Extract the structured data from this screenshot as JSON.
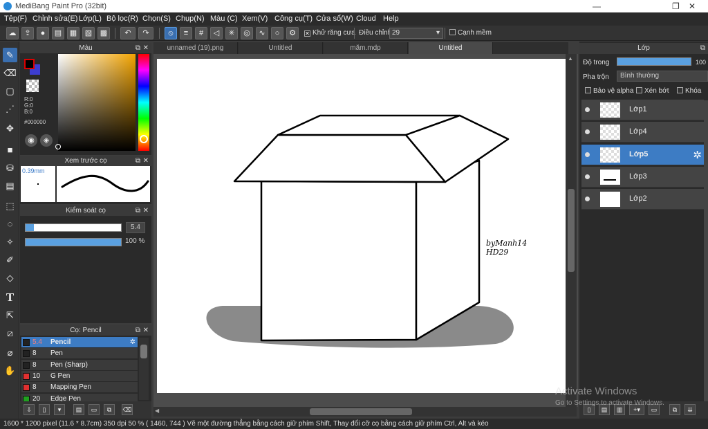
{
  "window": {
    "title": "MediBang Paint Pro (32bit)",
    "minimize": "—",
    "maximize": "❐",
    "close": "✕"
  },
  "menu": [
    "Tệp(F)",
    "Chỉnh sửa(E)",
    "Lớp(L)",
    "Bộ lọc(R)",
    "Chọn(S)",
    "Chụp(N)",
    "Màu (C)",
    "Xem(V)",
    "Công cụ(T)",
    "Cửa sổ(W)",
    "Cloud",
    "Help"
  ],
  "toolbar": {
    "antialias_label": "Khử răng cưa",
    "adjust_label": "Điều chỉnh",
    "adjust_value": "29",
    "edge_label": "Cạnh mềm"
  },
  "color_panel": {
    "title": "Màu",
    "r": "R:0",
    "g": "G:0",
    "b": "B:0",
    "hex": "#000000"
  },
  "brush_preview": {
    "title": "Xem trước cọ",
    "size": "0.39mm"
  },
  "brush_control": {
    "title": "Kiểm soát cọ",
    "size_value": "5.4",
    "opacity_value": "100 %"
  },
  "brush_list": {
    "title": "Cọ: Pencil",
    "items": [
      {
        "size": "5.4",
        "name": "Pencil",
        "color": "#222222"
      },
      {
        "size": "8",
        "name": "Pen",
        "color": "#222222"
      },
      {
        "size": "8",
        "name": "Pen (Sharp)",
        "color": "#222222"
      },
      {
        "size": "10",
        "name": "G Pen",
        "color": "#e03030"
      },
      {
        "size": "8",
        "name": "Mapping Pen",
        "color": "#e03030"
      },
      {
        "size": "20",
        "name": "Edge Pen",
        "color": "#20a020"
      }
    ]
  },
  "tabs": [
    "unnamed (19).png",
    "Untitled",
    "măm.mdp",
    "Untitled"
  ],
  "canvas": {
    "signature_line1": "byManh14",
    "signature_line2": "HD29"
  },
  "layer_panel": {
    "title": "Lớp",
    "opacity_label": "Độ trong",
    "opacity_value": "100",
    "blend_label": "Pha trộn",
    "blend_value": "Bình thường",
    "protect_alpha": "Bảo vệ alpha",
    "clipping": "Xén bớt",
    "lock": "Khóa",
    "layers": [
      {
        "name": "Lớp1"
      },
      {
        "name": "Lớp4"
      },
      {
        "name": "Lớp5"
      },
      {
        "name": "Lớp3"
      },
      {
        "name": "Lớp2"
      }
    ]
  },
  "watermark": {
    "line1": "Activate Windows",
    "line2": "Go to Settings to activate Windows."
  },
  "status": {
    "text": "1600 * 1200 pixel   (11.6 * 8.7cm)   350 dpi   50 %   ( 1460, 744 )   Vẽ một đường thẳng bằng cách giữ phím Shift, Thay đổi cỡ cọ bằng cách giữ phím Ctrl, Alt và kéo"
  }
}
